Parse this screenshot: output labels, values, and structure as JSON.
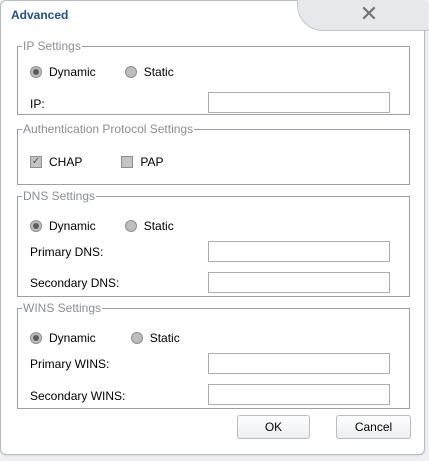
{
  "dialog": {
    "title": "Advanced",
    "close_glyph": "✕"
  },
  "ip": {
    "legend": "IP Settings",
    "dynamic_label": "Dynamic",
    "static_label": "Static",
    "selected": "Dynamic",
    "ip_label": "IP:",
    "ip_value": ""
  },
  "auth": {
    "legend": "Authentication Protocol Settings",
    "chap_label": "CHAP",
    "chap_checked": true,
    "pap_label": "PAP",
    "pap_checked": false
  },
  "dns": {
    "legend": "DNS Settings",
    "dynamic_label": "Dynamic",
    "static_label": "Static",
    "selected": "Dynamic",
    "primary_label": "Primary DNS:",
    "primary_value": "",
    "secondary_label": "Secondary DNS:",
    "secondary_value": ""
  },
  "wins": {
    "legend": "WINS Settings",
    "dynamic_label": "Dynamic",
    "static_label": "Static",
    "selected": "Dynamic",
    "primary_label": "Primary WINS:",
    "primary_value": "",
    "secondary_label": "Secondary WINS:",
    "secondary_value": ""
  },
  "footer": {
    "ok_label": "OK",
    "cancel_label": "Cancel"
  },
  "colors": {
    "title": "#1e4f8a",
    "legend": "#8a8f94",
    "border": "#9aa0a6"
  }
}
